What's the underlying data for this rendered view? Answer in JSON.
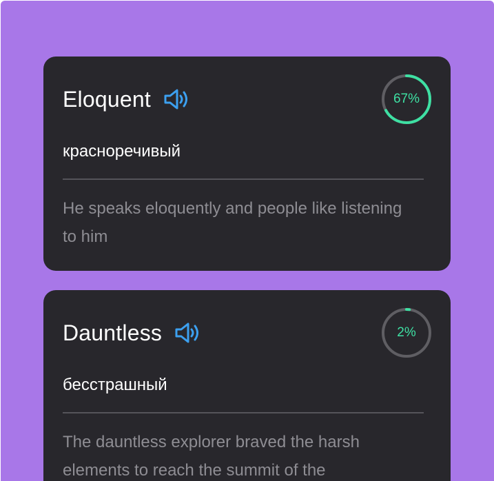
{
  "cards": [
    {
      "word": "Eloquent",
      "progress_label": "67%",
      "progress": 0.67,
      "translation": "красноречивый",
      "example": "He speaks eloquently and people like listening to him"
    },
    {
      "word": "Dauntless",
      "progress_label": "2%",
      "progress": 0.02,
      "translation": "бесстрашный",
      "example": "The dauntless explorer braved the harsh elements to reach the summit of the"
    }
  ],
  "icons": {
    "speaker": "speaker-icon"
  },
  "colors": {
    "background": "#a877e8",
    "card": "#28272c",
    "accent_blue": "#3ca0f0",
    "progress_green": "#3ee0a3",
    "progress_track": "#5f5e63",
    "muted_text": "#8e8d93"
  }
}
